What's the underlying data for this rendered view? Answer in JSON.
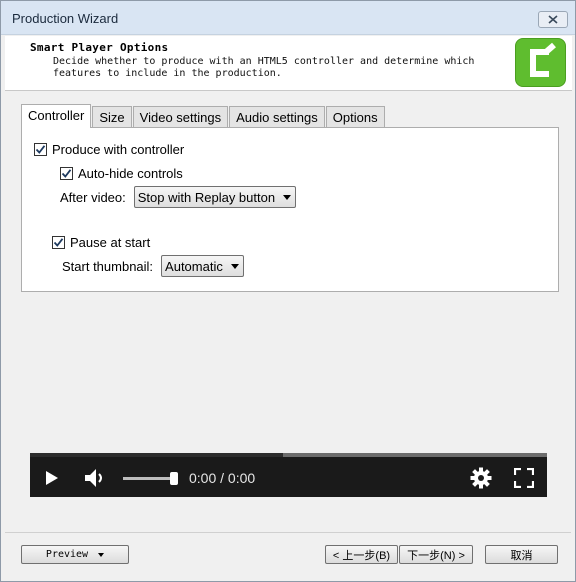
{
  "window": {
    "title": "Production Wizard"
  },
  "header": {
    "title": "Smart Player Options",
    "description": "Decide whether to produce with an HTML5 controller and determine which\nfeatures to include in the production.",
    "logo_icon": "camtasia-logo",
    "logo_color": "#5fbd2f"
  },
  "tabs": [
    {
      "label": "Controller",
      "active": true
    },
    {
      "label": "Size",
      "active": false
    },
    {
      "label": "Video settings",
      "active": false
    },
    {
      "label": "Audio settings",
      "active": false
    },
    {
      "label": "Options",
      "active": false
    }
  ],
  "controller": {
    "produce_with_controller": {
      "label": "Produce with controller",
      "checked": true
    },
    "auto_hide_controls": {
      "label": "Auto-hide controls",
      "checked": true
    },
    "after_video": {
      "label": "After video:",
      "value": "Stop with Replay button"
    },
    "pause_at_start": {
      "label": "Pause at start",
      "checked": true
    },
    "start_thumbnail": {
      "label": "Start thumbnail:",
      "value": "Automatic"
    }
  },
  "player": {
    "time": "0:00 / 0:00",
    "progress": 0.49,
    "volume": 1.0
  },
  "footer": {
    "preview_label": "Preview",
    "back_label": "< 上一步(B)",
    "next_label": "下一步(N) >",
    "cancel_label": "取消"
  }
}
